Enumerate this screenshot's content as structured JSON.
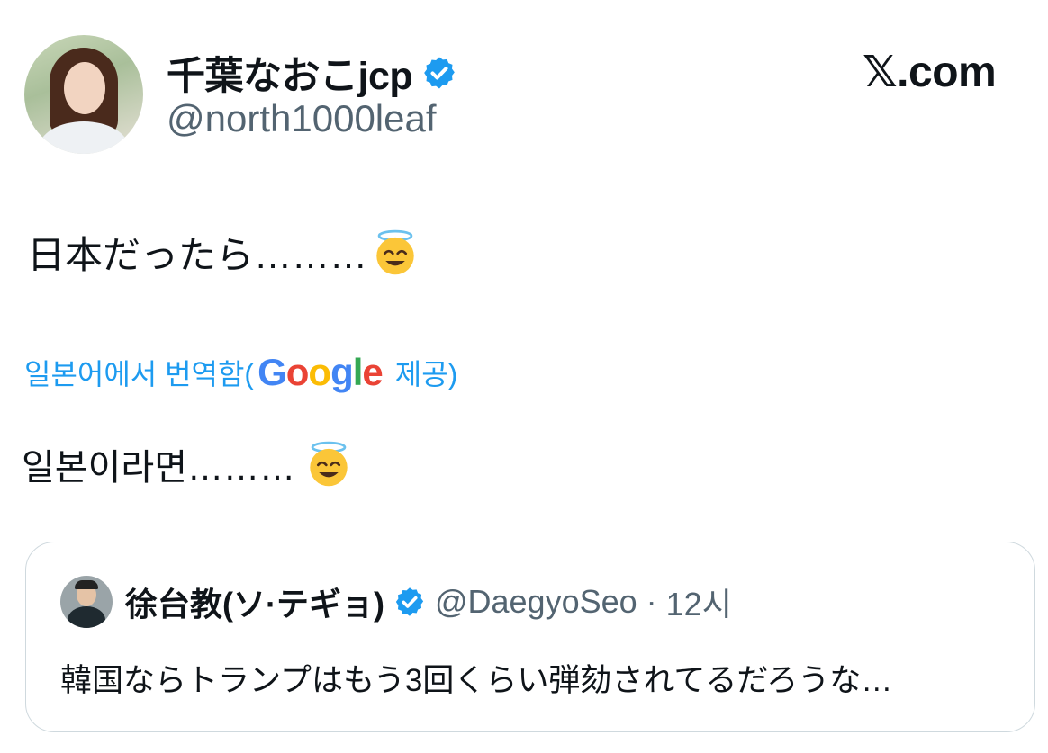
{
  "author": {
    "display_name": "千葉なおこjcp",
    "handle": "@north1000leaf",
    "verified_icon": "verified-badge-icon"
  },
  "brand": {
    "label": "𝕏.com"
  },
  "tweet": {
    "text": "日本だったら………",
    "emoji": "smiling-face-with-halo-icon"
  },
  "translation": {
    "prefix": "일본어에서 번역함(",
    "provider": "Google",
    "suffix": "제공)",
    "text": "일본이라면………",
    "link_color": "#1d9bf0"
  },
  "quoted_tweet": {
    "display_name": "徐台教(ソ·テギョ)",
    "handle": "@DaegyoSeo",
    "time": "12시",
    "separator": "·",
    "text": "韓国ならトランプはもう3回くらい弾劾されてるだろうな…"
  },
  "colors": {
    "verified": "#1d9bf0",
    "secondary_text": "#536471"
  }
}
